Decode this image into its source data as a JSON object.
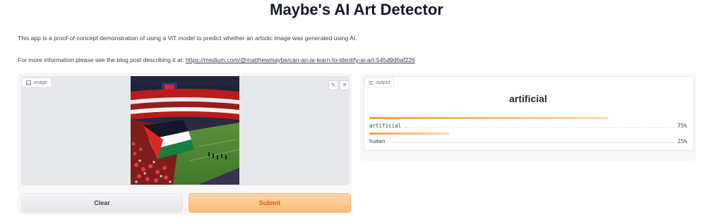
{
  "page": {
    "title": "Maybe's AI Art Detector",
    "description": "This app is a proof-of-concept demonstration of using a ViT model to predict whether an artistic image was generated using AI.",
    "more_info_prefix": "For more information please see the blog post describing it at: ",
    "more_info_link": "https://medium.com/@matthewmaybe/can-an-ai-learn-to-identify-ai-art-545d9d6af226"
  },
  "input": {
    "label": "image",
    "icon": "image-icon",
    "edit_icon": "pencil-icon",
    "close_icon": "close-icon"
  },
  "actions": {
    "clear_label": "Clear",
    "submit_label": "Submit"
  },
  "output": {
    "label": "output",
    "icon": "label-icon",
    "top_label": "artificial",
    "confidences": [
      {
        "label": "artificial",
        "value": 0.75,
        "display": "75%"
      },
      {
        "label": "human",
        "value": 0.25,
        "display": "25%"
      }
    ]
  },
  "colors": {
    "accent": "#f97316",
    "submit_bg": "#fdba74",
    "clear_bg": "#e5e7eb"
  }
}
